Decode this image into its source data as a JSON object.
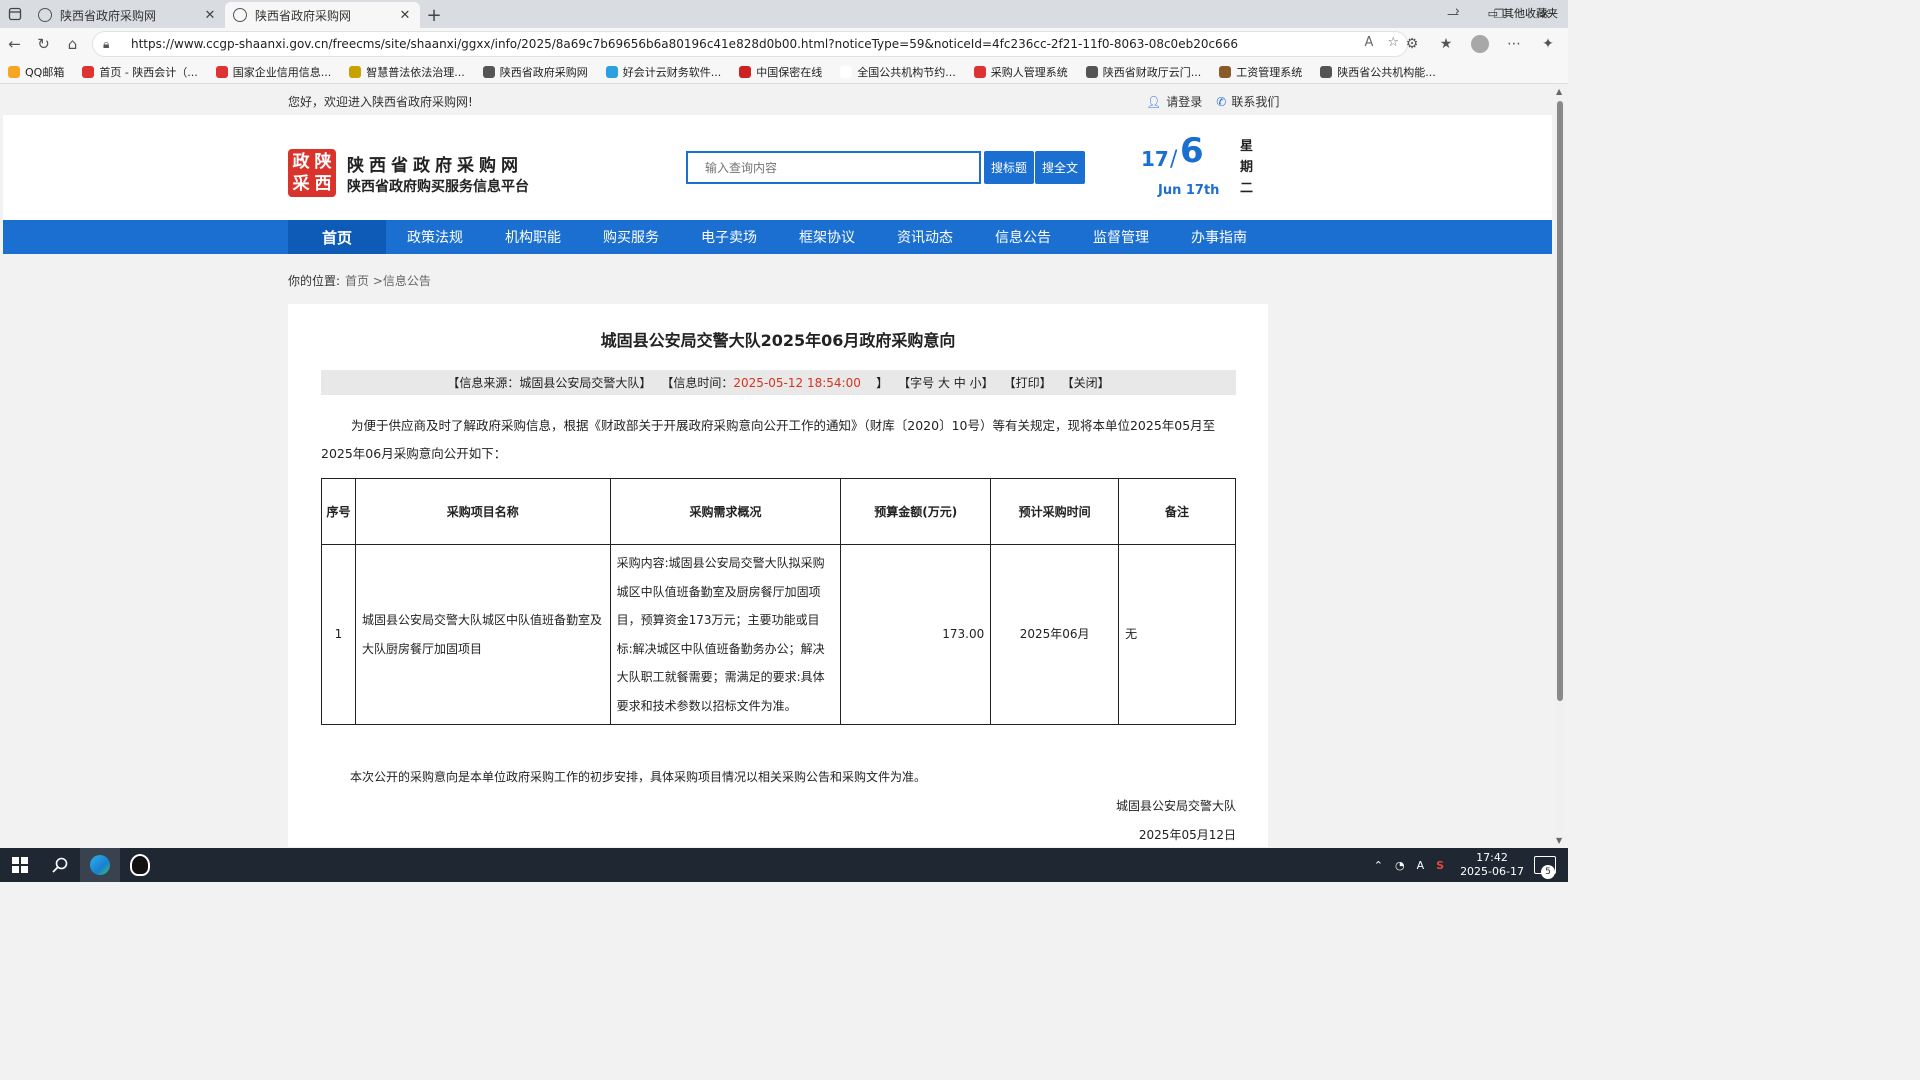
{
  "browser": {
    "tabs": [
      {
        "title": "陕西省政府采购网",
        "active": false
      },
      {
        "title": "陕西省政府采购网",
        "active": true
      }
    ],
    "url": "https://www.ccgp-shaanxi.gov.cn/freecms/site/shaanxi/ggxx/info/2025/8a69c7b69656b6a80196c41e828d0b00.html?noticeType=59&noticeId=4fc236cc-2f21-11f0-8063-08c0eb20c666",
    "bookmarks": [
      {
        "label": "QQ邮箱",
        "color": "#f5a623"
      },
      {
        "label": "首页 - 陕西会计（...",
        "color": "#d33"
      },
      {
        "label": "国家企业信用信息...",
        "color": "#d33"
      },
      {
        "label": "智慧普法依法治理...",
        "color": "#c8a200"
      },
      {
        "label": "陕西省政府采购网",
        "color": "#555"
      },
      {
        "label": "好会计云财务软件...",
        "color": "#2aa0e0"
      },
      {
        "label": "中国保密在线",
        "color": "#c22"
      },
      {
        "label": "全国公共机构节约...",
        "color": "#ffffff"
      },
      {
        "label": "采购人管理系统",
        "color": "#d33"
      },
      {
        "label": "陕西省财政厅云门...",
        "color": "#555"
      },
      {
        "label": "工资管理系统",
        "color": "#8a5a2a"
      },
      {
        "label": "陕西省公共机构能...",
        "color": "#555"
      }
    ],
    "other_bookmarks": "其他收藏夹"
  },
  "site": {
    "welcome": "您好，欢迎进入陕西省政府采购网!",
    "login": "请登录",
    "contact": "联系我们",
    "logo_chars": [
      "政",
      "陕",
      "采",
      "西"
    ],
    "name": "陕西省政府采购网",
    "subtitle": "陕西省政府购买服务信息平台",
    "search_placeholder": "输入查询内容",
    "search_title_btn": "搜标题",
    "search_full_btn": "搜全文",
    "date": {
      "day": "17",
      "sep": "/",
      "month": "6",
      "en": "Jun 17th",
      "week": "星期二"
    },
    "nav": [
      "首页",
      "政策法规",
      "机构职能",
      "购买服务",
      "电子卖场",
      "框架协议",
      "资讯动态",
      "信息公告",
      "监督管理",
      "办事指南"
    ],
    "nav_active": 0,
    "crumb_label": "你的位置:",
    "crumb_path": "首页 >信息公告"
  },
  "article": {
    "title": "城固县公安局交警大队2025年06月政府采购意向",
    "meta_source": "【信息来源：城固县公安局交警大队】",
    "meta_time_label": "【信息时间：",
    "meta_time_value": "2025-05-12 18:54:00",
    "meta_time_close": "】",
    "meta_font": "【字号 大 中 小】",
    "meta_print": "【打印】",
    "meta_close": "【关闭】",
    "intro": "为便于供应商及时了解政府采购信息，根据《财政部关于开展政府采购意向公开工作的通知》（财库〔2020〕10号）等有关规定，现将本单位2025年05月至2025年06月采购意向公开如下：",
    "table": {
      "headers": [
        "序号",
        "采购项目名称",
        "采购需求概况",
        "预算金额(万元)",
        "预计采购时间",
        "备注"
      ],
      "rows": [
        {
          "idx": "1",
          "name": "城固县公安局交警大队城区中队值班备勤室及大队厨房餐厅加固项目",
          "desc": "采购内容:城固县公安局交警大队拟采购城区中队值班备勤室及厨房餐厅加固项目，预算资金173万元；主要功能或目标:解决城区中队值班备勤务办公；解决大队职工就餐需要；需满足的要求:具体要求和技术参数以招标文件为准。",
          "amount": "173.00",
          "time": "2025年06月",
          "note": "无"
        }
      ]
    },
    "footnote": "本次公开的采购意向是本单位政府采购工作的初步安排，具体采购项目情况以相关采购公告和采购文件为准。",
    "signature": "城固县公安局交警大队",
    "sign_date": "2025年05月12日"
  },
  "taskbar": {
    "time": "17:42",
    "date": "2025-06-17",
    "notifications": "5"
  }
}
